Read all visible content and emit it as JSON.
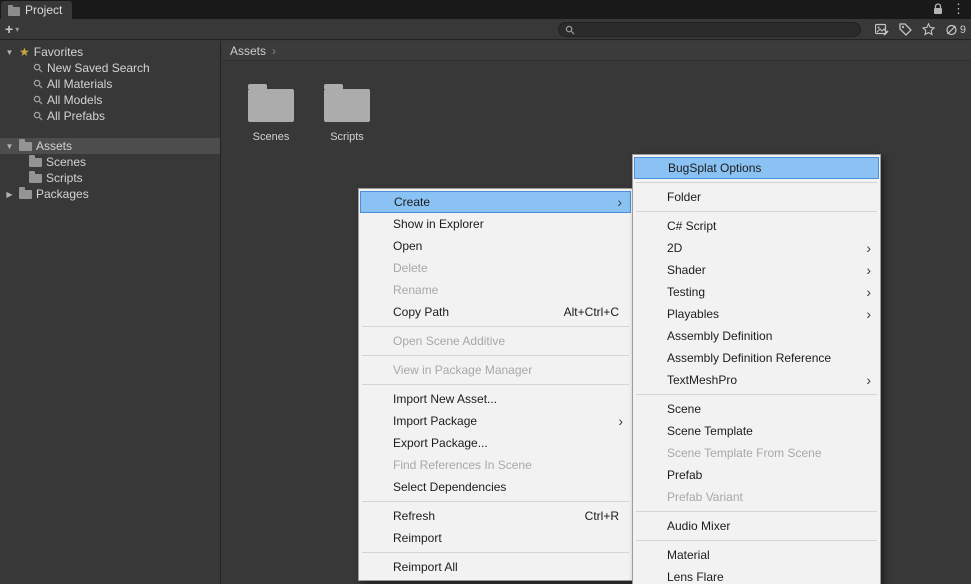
{
  "window": {
    "tab_label": "Project"
  },
  "toolbar": {
    "add_button": "+",
    "dropdown_caret": "▾",
    "search_placeholder": "",
    "search_value": "",
    "hidden_count": "9"
  },
  "sidebar": {
    "favorites": {
      "label": "Favorites",
      "items": [
        "New Saved Search",
        "All Materials",
        "All Models",
        "All Prefabs"
      ]
    },
    "assets": {
      "label": "Assets",
      "children": [
        "Scenes",
        "Scripts"
      ]
    },
    "packages": {
      "label": "Packages"
    }
  },
  "main": {
    "breadcrumb": "Assets",
    "breadcrumb_separator": "›",
    "folders": [
      "Scenes",
      "Scripts"
    ]
  },
  "context_menu": {
    "items": [
      {
        "label": "Create",
        "highlighted": true,
        "submenu": true
      },
      {
        "label": "Show in Explorer"
      },
      {
        "label": "Open"
      },
      {
        "label": "Delete",
        "disabled": true
      },
      {
        "label": "Rename",
        "disabled": true
      },
      {
        "label": "Copy Path",
        "shortcut": "Alt+Ctrl+C"
      },
      {
        "separator": true
      },
      {
        "label": "Open Scene Additive",
        "disabled": true
      },
      {
        "separator": true
      },
      {
        "label": "View in Package Manager",
        "disabled": true
      },
      {
        "separator": true
      },
      {
        "label": "Import New Asset..."
      },
      {
        "label": "Import Package",
        "submenu": true
      },
      {
        "label": "Export Package..."
      },
      {
        "label": "Find References In Scene",
        "disabled": true
      },
      {
        "label": "Select Dependencies"
      },
      {
        "separator": true
      },
      {
        "label": "Refresh",
        "shortcut": "Ctrl+R"
      },
      {
        "label": "Reimport"
      },
      {
        "separator": true
      },
      {
        "label": "Reimport All"
      }
    ]
  },
  "create_submenu": {
    "items": [
      {
        "label": "BugSplat Options",
        "highlighted": true
      },
      {
        "separator": true
      },
      {
        "label": "Folder"
      },
      {
        "separator": true
      },
      {
        "label": "C# Script"
      },
      {
        "label": "2D",
        "submenu": true
      },
      {
        "label": "Shader",
        "submenu": true
      },
      {
        "label": "Testing",
        "submenu": true
      },
      {
        "label": "Playables",
        "submenu": true
      },
      {
        "label": "Assembly Definition"
      },
      {
        "label": "Assembly Definition Reference"
      },
      {
        "label": "TextMeshPro",
        "submenu": true
      },
      {
        "separator": true
      },
      {
        "label": "Scene"
      },
      {
        "label": "Scene Template"
      },
      {
        "label": "Scene Template From Scene",
        "disabled": true
      },
      {
        "label": "Prefab"
      },
      {
        "label": "Prefab Variant",
        "disabled": true
      },
      {
        "separator": true
      },
      {
        "label": "Audio Mixer"
      },
      {
        "separator": true
      },
      {
        "label": "Material"
      },
      {
        "label": "Lens Flare"
      }
    ]
  },
  "colors": {
    "panel_bg": "#383838",
    "strip_bg": "#191919",
    "selection_bg": "#4D4D4D",
    "menu_bg": "#F2F2F2",
    "menu_highlight": "#8AC2F4",
    "menu_highlight_border": "#4A90D9",
    "menu_disabled_text": "#A8A8A8",
    "favorites_star": "#C7A93C"
  }
}
